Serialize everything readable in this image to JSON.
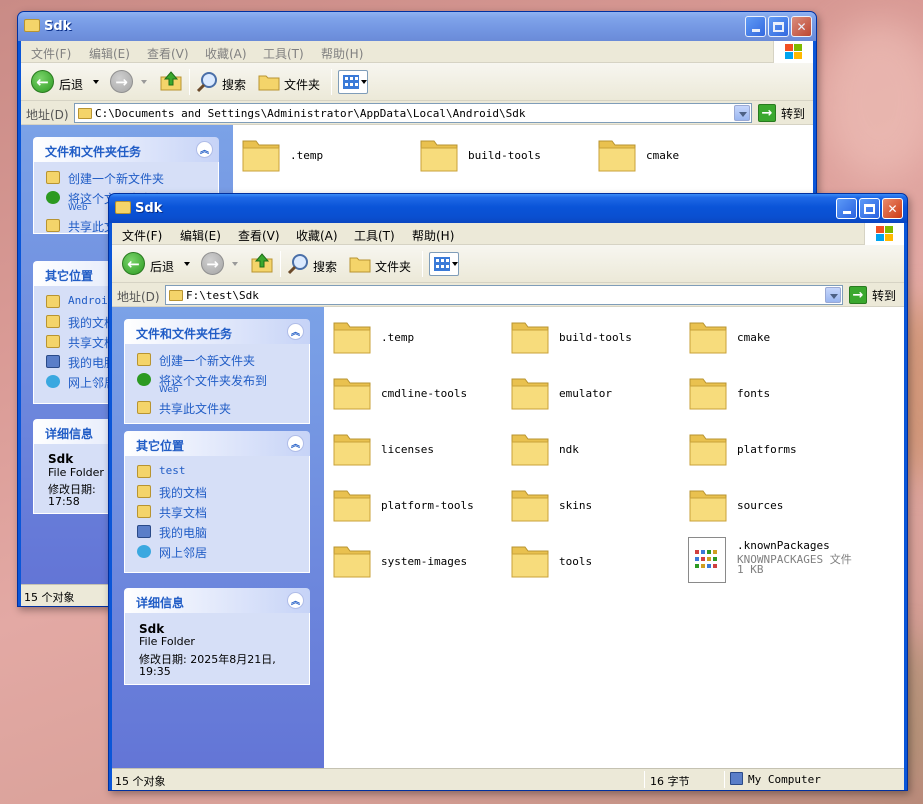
{
  "back_window": {
    "title": "Sdk",
    "menu": [
      "文件(F)",
      "编辑(E)",
      "查看(V)",
      "收藏(A)",
      "工具(T)",
      "帮助(H)"
    ],
    "toolbar": {
      "back": "后退",
      "search": "搜索",
      "folders": "文件夹"
    },
    "address": {
      "label": "地址(D)",
      "path": "C:\\Documents and Settings\\Administrator\\AppData\\Local\\Android\\Sdk",
      "go": "转到"
    },
    "tasks_panel": {
      "title": "文件和文件夹任务",
      "items": [
        {
          "label": "创建一个新文件夹",
          "sub": ""
        },
        {
          "label": "将这个文件夹发布到",
          "sub": "Web"
        },
        {
          "label": "共享此文件夹",
          "sub": ""
        }
      ]
    },
    "places_panel": {
      "title": "其它位置",
      "items": [
        "Android",
        "我的文档",
        "共享文档",
        "我的电脑",
        "网上邻居"
      ]
    },
    "details_panel": {
      "title": "详细信息",
      "name": "Sdk",
      "type": "File Folder",
      "modified_label": "修改日期:",
      "modified_time": "17:58"
    },
    "files": [
      ".temp",
      "build-tools",
      "cmake"
    ],
    "status": "15 个对象"
  },
  "front_window": {
    "title": "Sdk",
    "menu": [
      "文件(F)",
      "编辑(E)",
      "查看(V)",
      "收藏(A)",
      "工具(T)",
      "帮助(H)"
    ],
    "toolbar": {
      "back": "后退",
      "search": "搜索",
      "folders": "文件夹"
    },
    "address": {
      "label": "地址(D)",
      "path": "F:\\test\\Sdk",
      "go": "转到"
    },
    "tasks_panel": {
      "title": "文件和文件夹任务",
      "items": [
        {
          "label": "创建一个新文件夹",
          "sub": ""
        },
        {
          "label": "将这个文件夹发布到",
          "sub": "Web"
        },
        {
          "label": "共享此文件夹",
          "sub": ""
        }
      ]
    },
    "places_panel": {
      "title": "其它位置",
      "items": [
        "test",
        "我的文档",
        "共享文档",
        "我的电脑",
        "网上邻居"
      ]
    },
    "details_panel": {
      "title": "详细信息",
      "name": "Sdk",
      "type": "File Folder",
      "modified": "修改日期: 2025年8月21日,",
      "modified_time": "19:35"
    },
    "folders": [
      ".temp",
      "build-tools",
      "cmake",
      "cmdline-tools",
      "emulator",
      "fonts",
      "licenses",
      "ndk",
      "platforms",
      "platform-tools",
      "skins",
      "sources",
      "system-images",
      "tools"
    ],
    "file": {
      "name": ".knownPackages",
      "type": "KNOWNPACKAGES 文件",
      "size": "1 KB"
    },
    "status": {
      "count": "15 个对象",
      "size": "16 字节",
      "location": "My Computer"
    }
  },
  "colors": {
    "titlebar": "#0a54d8",
    "taskpane": "#7ba2e7",
    "panel_link": "#215dc6",
    "folder": "#f4d46a"
  }
}
